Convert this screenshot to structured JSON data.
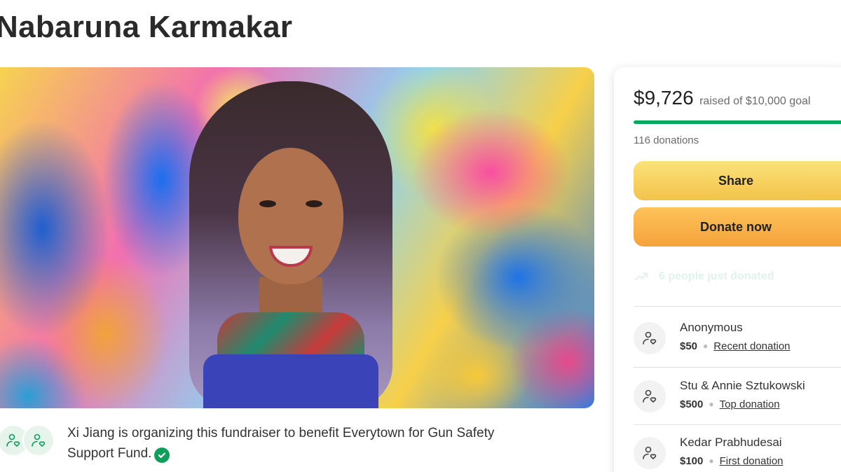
{
  "page": {
    "title": "Nabaruna Karmakar"
  },
  "organizer": {
    "text": "Xi Jiang is organizing this fundraiser to benefit Everytown for Gun Safety Support Fund.",
    "avatar_icon": "heart-hand-icon",
    "verified_icon": "check-circle-icon"
  },
  "donation_card": {
    "amount_raised": "$9,726",
    "goal_text": "raised of $10,000 goal",
    "progress_fraction": 0.9726,
    "donations_count": "116 donations",
    "share_label": "Share",
    "donate_label": "Donate now",
    "recent_activity": "6 people just donated",
    "donors": [
      {
        "name": "Anonymous",
        "amount": "$50",
        "tag": "Recent donation"
      },
      {
        "name": "Stu & Annie Sztukowski",
        "amount": "$500",
        "tag": "Top donation"
      },
      {
        "name": "Kedar Prabhudesai",
        "amount": "$100",
        "tag": "First donation"
      }
    ]
  },
  "colors": {
    "accent_green": "#02a95c",
    "share_yellow": "#f3c34a",
    "donate_orange": "#f6a23a"
  }
}
